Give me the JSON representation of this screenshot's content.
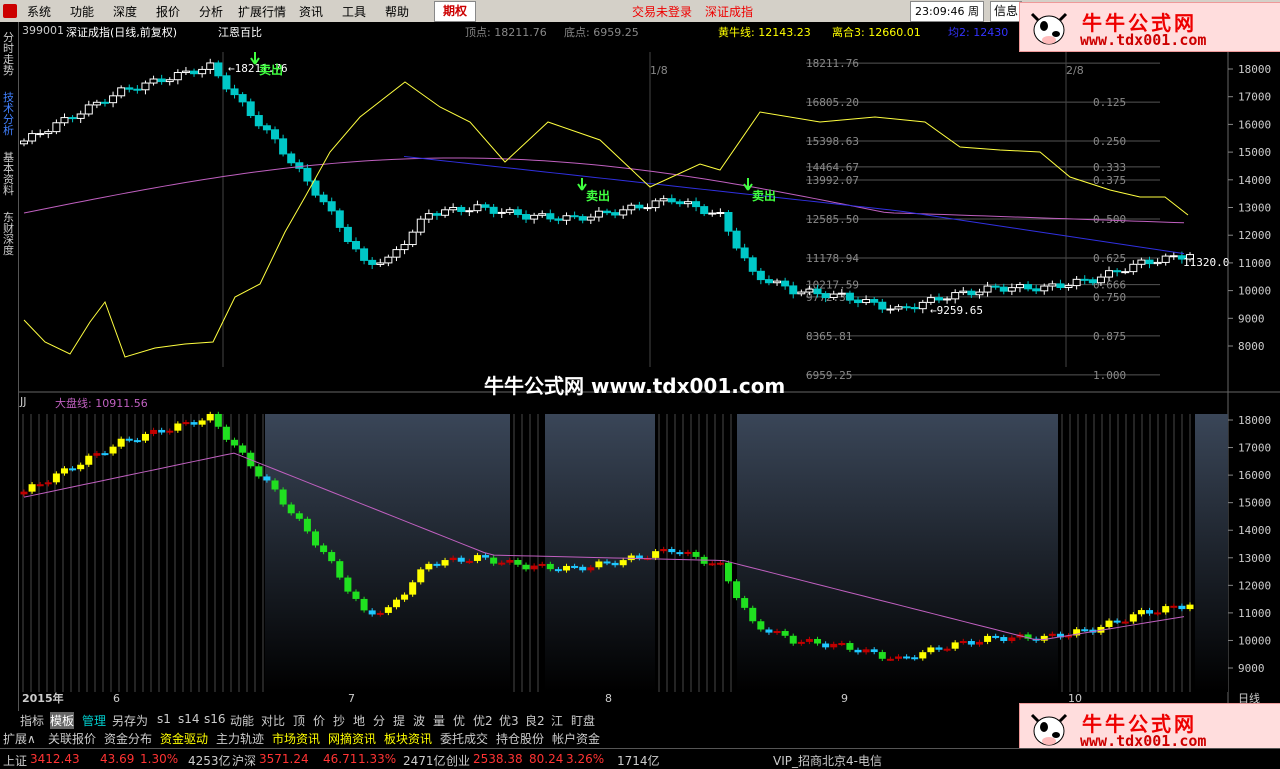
{
  "menubar": {
    "items": [
      "系统",
      "功能",
      "深度",
      "报价",
      "分析",
      "扩展行情",
      "资讯",
      "工具",
      "帮助"
    ],
    "qihuo_tab": "期权",
    "status": "交易未登录",
    "index_name": "深证成指",
    "clock": "23:09:46",
    "weekday": "周六",
    "info": "信息"
  },
  "watermark": {
    "title": "牛牛公式网",
    "url": "www.tdx001.com"
  },
  "sidebar": {
    "tabs": [
      "分时走势",
      "技术分析",
      "基本资料",
      "东财深度"
    ]
  },
  "header": {
    "code": "399001",
    "name": "深证成指(日线,前复权)",
    "method": "江恩百比",
    "peak_label": "顶点:",
    "peak_value": "18211.76",
    "bottom_label": "底点:",
    "bottom_value": "6959.25",
    "hn_label": "黄牛线:",
    "hn_value": "12143.23",
    "lh_label": "离合3:",
    "lh_value": "12660.01",
    "ma2_label": "均2:",
    "ma2_value": "12430"
  },
  "main_chart": {
    "price_axis": [
      "18000",
      "17000",
      "16000",
      "15000",
      "14000",
      "13000",
      "12000",
      "11000",
      "10000",
      "9000",
      "8000"
    ],
    "gann_levels": [
      {
        "price": "18211.76",
        "ratio": ""
      },
      {
        "price": "16805.20",
        "ratio": "0.125"
      },
      {
        "price": "15398.63",
        "ratio": "0.250"
      },
      {
        "price": "14464.67",
        "ratio": "0.333"
      },
      {
        "price": "13992.07",
        "ratio": "0.375"
      },
      {
        "price": "12585.50",
        "ratio": "0.500"
      },
      {
        "price": "11178.94",
        "ratio": "0.625"
      },
      {
        "price": "10217.59",
        "ratio": "0.666"
      },
      {
        "price": "9772.37",
        "ratio": "0.750"
      },
      {
        "price": "8365.81",
        "ratio": "0.875"
      },
      {
        "price": "6959.25",
        "ratio": "1.000"
      }
    ],
    "high_label": "18211.76",
    "low_label": "9259.65",
    "last_label": "11320.0",
    "sell_label": "卖出",
    "period_labels": [
      "1/8",
      "2/8"
    ]
  },
  "sub_chart": {
    "name": "JJ",
    "dpx_label": "大盘线:",
    "dpx_value": "10911.56",
    "price_axis": [
      "18000",
      "17000",
      "16000",
      "15000",
      "14000",
      "13000",
      "12000",
      "11000",
      "10000",
      "9000"
    ],
    "x_labels": [
      "2015年",
      "6",
      "7",
      "8",
      "9",
      "10"
    ],
    "axis_corner": "日线"
  },
  "center_watermark": "牛牛公式网 www.tdx001.com",
  "toolbar": {
    "items": [
      "指标",
      "模板",
      "管理",
      "另存为",
      "s1",
      "s14",
      "s16",
      "动能",
      "对比",
      "顶",
      "价",
      "抄",
      "地",
      "分",
      "提",
      "波",
      "量",
      "优",
      "优2",
      "优3",
      "良2",
      "江",
      "盯盘"
    ]
  },
  "toolbar2": {
    "items": [
      "扩展∧",
      "关联报价",
      "资金分布",
      "资金驱动",
      "主力轨迹",
      "市场资讯",
      "网摘资讯",
      "板块资讯",
      "委托成交",
      "持仓股份",
      "帐户资金"
    ]
  },
  "status_bar": {
    "sh_name": "上证",
    "sh_price": "3412.43",
    "sh_change": "43.69",
    "sh_pct": "1.30%",
    "sh_amount": "4253亿",
    "hs_name": "沪深",
    "hs_price": "3571.24",
    "hs_change": "46.71",
    "hs_pct": "1.33%",
    "hs_amount": "2471亿",
    "cy_name": "创业",
    "cy_price": "2538.38",
    "cy_change": "80.24",
    "cy_pct": "3.26%",
    "cy_amount": "1714亿",
    "server": "VIP_招商北京4-电信"
  },
  "colors": {
    "up": "#ffffff",
    "down": "#00c8c8",
    "yellow_line": "#ffff40",
    "magenta": "#c060c0",
    "blue": "#3030e0",
    "sell": "#40ff40"
  }
}
